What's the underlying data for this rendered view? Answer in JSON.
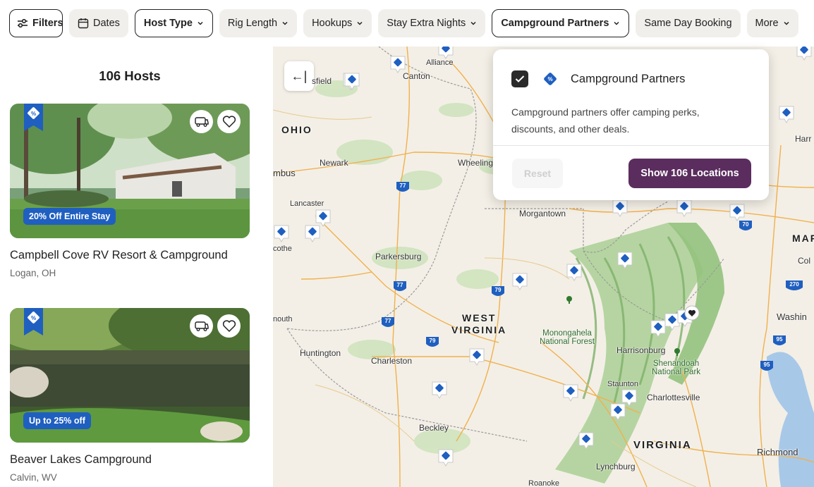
{
  "filters": [
    {
      "label": "Filters",
      "icon": "sliders-icon",
      "outlined": true,
      "chevron": false
    },
    {
      "label": "Dates",
      "icon": "calendar-icon",
      "outlined": false,
      "chevron": false
    },
    {
      "label": "Host Type",
      "outlined": true,
      "chevron": true
    },
    {
      "label": "Rig Length",
      "outlined": false,
      "chevron": true
    },
    {
      "label": "Hookups",
      "outlined": false,
      "chevron": true
    },
    {
      "label": "Stay Extra Nights",
      "outlined": false,
      "chevron": true
    },
    {
      "label": "Campground Partners",
      "outlined": true,
      "chevron": true
    },
    {
      "label": "Same Day Booking",
      "outlined": false,
      "chevron": false
    },
    {
      "label": "More",
      "outlined": false,
      "chevron": true
    }
  ],
  "list": {
    "count_label": "106 Hosts",
    "cards": [
      {
        "name": "Campbell Cove RV Resort & Campground",
        "location": "Logan, OH",
        "deal": "20% Off Entire Stay"
      },
      {
        "name": "Beaver Lakes Campground",
        "location": "Calvin, WV",
        "deal": "Up to 25% off"
      }
    ]
  },
  "map": {
    "collapse_label": "←|",
    "labels": [
      {
        "text": "OHIO",
        "kind": "state"
      },
      {
        "text": "WEST",
        "kind": "state"
      },
      {
        "text": "VIRGINIA",
        "kind": "state"
      },
      {
        "text": "VIRGINIA",
        "kind": "state"
      },
      {
        "text": "MAR",
        "kind": "state"
      },
      {
        "text": "Canton",
        "kind": "city"
      },
      {
        "text": "Alliance",
        "kind": "city"
      },
      {
        "text": "sfield",
        "kind": "city"
      },
      {
        "text": "Newark",
        "kind": "city"
      },
      {
        "text": "mbus",
        "kind": "city"
      },
      {
        "text": "Wheeling",
        "kind": "city"
      },
      {
        "text": "Lancaster",
        "kind": "city"
      },
      {
        "text": "Morgantown",
        "kind": "city"
      },
      {
        "text": "cothe",
        "kind": "city"
      },
      {
        "text": "Parkersburg",
        "kind": "city"
      },
      {
        "text": "nouth",
        "kind": "city"
      },
      {
        "text": "Huntington",
        "kind": "city"
      },
      {
        "text": "Charleston",
        "kind": "city"
      },
      {
        "text": "Monongahela\nNational Forest",
        "kind": "park"
      },
      {
        "text": "Harrisonburg",
        "kind": "city"
      },
      {
        "text": "Shenandoah\nNational Park",
        "kind": "park"
      },
      {
        "text": "Staunton",
        "kind": "city"
      },
      {
        "text": "Charlottesville",
        "kind": "city"
      },
      {
        "text": "Beckley",
        "kind": "city"
      },
      {
        "text": "Lynchburg",
        "kind": "city"
      },
      {
        "text": "Roanoke",
        "kind": "city"
      },
      {
        "text": "Richmond",
        "kind": "city"
      },
      {
        "text": "Washin",
        "kind": "city"
      },
      {
        "text": "Harr",
        "kind": "city"
      },
      {
        "text": "Col",
        "kind": "city"
      }
    ],
    "shields": [
      "77",
      "77",
      "77",
      "79",
      "79",
      "70",
      "270",
      "95",
      "95"
    ]
  },
  "popover": {
    "checked": true,
    "title": "Campground Partners",
    "description": "Campground partners offer camping perks, discounts, and other deals.",
    "reset_label": "Reset",
    "show_label": "Show 106 Locations"
  },
  "colors": {
    "brand_purple": "#5b2d5f",
    "deal_blue": "#1f5fc0",
    "chip_bg": "#f1efec"
  }
}
